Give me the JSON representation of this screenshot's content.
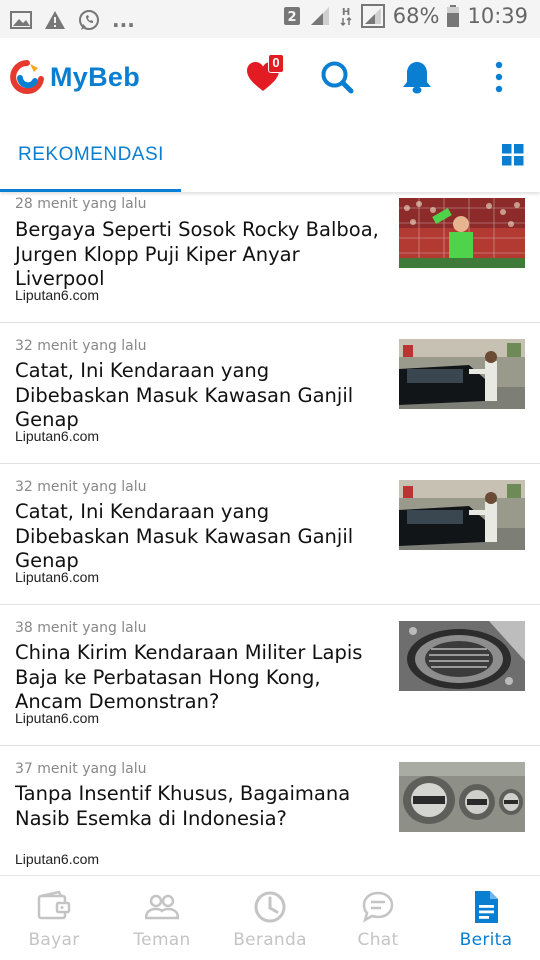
{
  "status_bar": {
    "left_icons": [
      "image-icon",
      "warning-icon",
      "whatsapp-icon"
    ],
    "overflow": "...",
    "sim_badge": "2",
    "network": "H",
    "battery": "68%",
    "time": "10:39"
  },
  "app_bar": {
    "logo": "MyBeb",
    "favorites_count": "0",
    "actions": [
      "heart-icon",
      "search-icon",
      "bell-icon",
      "more-vert-icon"
    ]
  },
  "tabs": {
    "active": "REKOMENDASI"
  },
  "feed": {
    "items": [
      {
        "time": "28 menit yang lalu",
        "title": "Bergaya Seperti Sosok Rocky Balboa, Jurgen Klopp Puji Kiper Anyar Liverpool",
        "source": "Liputan6.com",
        "thumb": "goalkeeper-photo"
      },
      {
        "time": "32 menit yang lalu",
        "title": "Catat, Ini Kendaraan yang Dibebaskan Masuk Kawasan Ganjil Genap",
        "source": "Liputan6.com",
        "thumb": "traffic-police-photo"
      },
      {
        "time": "32 menit yang lalu",
        "title": "Catat, Ini Kendaraan yang Dibebaskan Masuk Kawasan Ganjil Genap",
        "source": "Liputan6.com",
        "thumb": "traffic-police-photo"
      },
      {
        "time": "38 menit yang lalu",
        "title": "China Kirim Kendaraan Militer Lapis Baja ke Perbatasan Hong Kong, Ancam Demonstran?",
        "source": "Liputan6.com",
        "thumb": "armored-vehicle-photo"
      },
      {
        "time": "37 menit yang lalu",
        "title": "Tanpa Insentif Khusus, Bagaimana Nasib Esemka di Indonesia?",
        "source": "Liputan6.com",
        "thumb": "car-badge-photo"
      }
    ]
  },
  "bottom_nav": {
    "items": [
      {
        "label": "Bayar",
        "icon": "wallet-icon"
      },
      {
        "label": "Teman",
        "icon": "people-icon"
      },
      {
        "label": "Beranda",
        "icon": "clock-icon"
      },
      {
        "label": "Chat",
        "icon": "chat-bubble-icon"
      },
      {
        "label": "Berita",
        "icon": "article-icon"
      }
    ],
    "active": "Berita"
  },
  "colors": {
    "accent": "#0a7fd1",
    "badge": "#e31b23",
    "inactive": "#c4c4c4"
  }
}
